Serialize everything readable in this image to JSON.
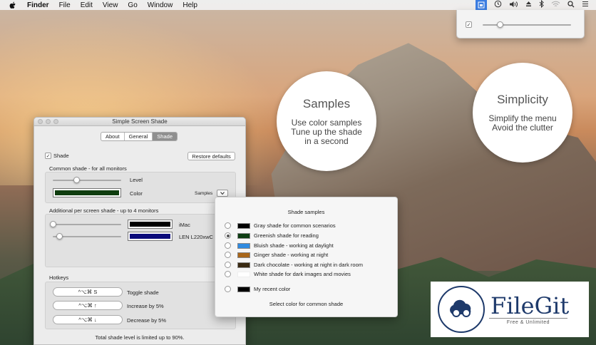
{
  "menubar": {
    "app": "Finder",
    "items": [
      "File",
      "Edit",
      "View",
      "Go",
      "Window",
      "Help"
    ]
  },
  "bubbles": {
    "samples": {
      "title": "Samples",
      "lines": [
        "Use color samples",
        "Tune up the shade",
        "in a second"
      ]
    },
    "simplicity": {
      "title": "Simplicity",
      "lines": [
        "Simplify the menu",
        "Avoid the clutter"
      ]
    }
  },
  "window": {
    "title": "Simple Screen Shade",
    "tabs": [
      "About",
      "General",
      "Shade"
    ],
    "active_tab": "Shade",
    "shade_checkbox_label": "Shade",
    "restore_defaults_label": "Restore defaults",
    "common_section_label": "Common shade - for all monitors",
    "level_label": "Level",
    "level_value": 0.35,
    "color_label": "Color",
    "samples_label": "Samples",
    "common_color": "#0f3d0f",
    "per_screen_label": "Additional per screen shade - up to 4 monitors",
    "monitors": [
      {
        "name": "iMac",
        "color": "#000000",
        "level": 0.0
      },
      {
        "name": "LEN L220xwC",
        "color": "#0a0a7a",
        "level": 0.1
      }
    ],
    "hotkeys_label": "Hotkeys",
    "hotkeys": [
      {
        "keys": "^⌥⌘ S",
        "action": "Toggle shade"
      },
      {
        "keys": "^⌥⌘ ↑",
        "action": "Increase by 5%"
      },
      {
        "keys": "^⌥⌘ ↓",
        "action": "Decrease by 5%"
      }
    ],
    "footer": "Total shade level is limited up to 90%."
  },
  "popover": {
    "title": "Shade samples",
    "items": [
      {
        "label": "Gray shade for common scenarios",
        "color": "#000000",
        "selected": false
      },
      {
        "label": "Greenish shade for reading",
        "color": "#0d3d12",
        "selected": true
      },
      {
        "label": "Bluish shade - working at daylight",
        "color": "#2f8ae0",
        "selected": false
      },
      {
        "label": "Ginger shade - working at night",
        "color": "#a8661a",
        "selected": false
      },
      {
        "label": "Dark chocolate - working at night in dark room",
        "color": "#3a2a12",
        "selected": false
      },
      {
        "label": "White shade for dark images and movies",
        "color": "#ffffff",
        "selected": false
      }
    ],
    "recent": {
      "label": "My recent color",
      "color": "#000000"
    },
    "footer": "Select color for common shade"
  },
  "menu_dropdown": {
    "slider_value": 0.2
  },
  "badge": {
    "name": "FileGit",
    "tagline": "Free & Unlimited"
  }
}
